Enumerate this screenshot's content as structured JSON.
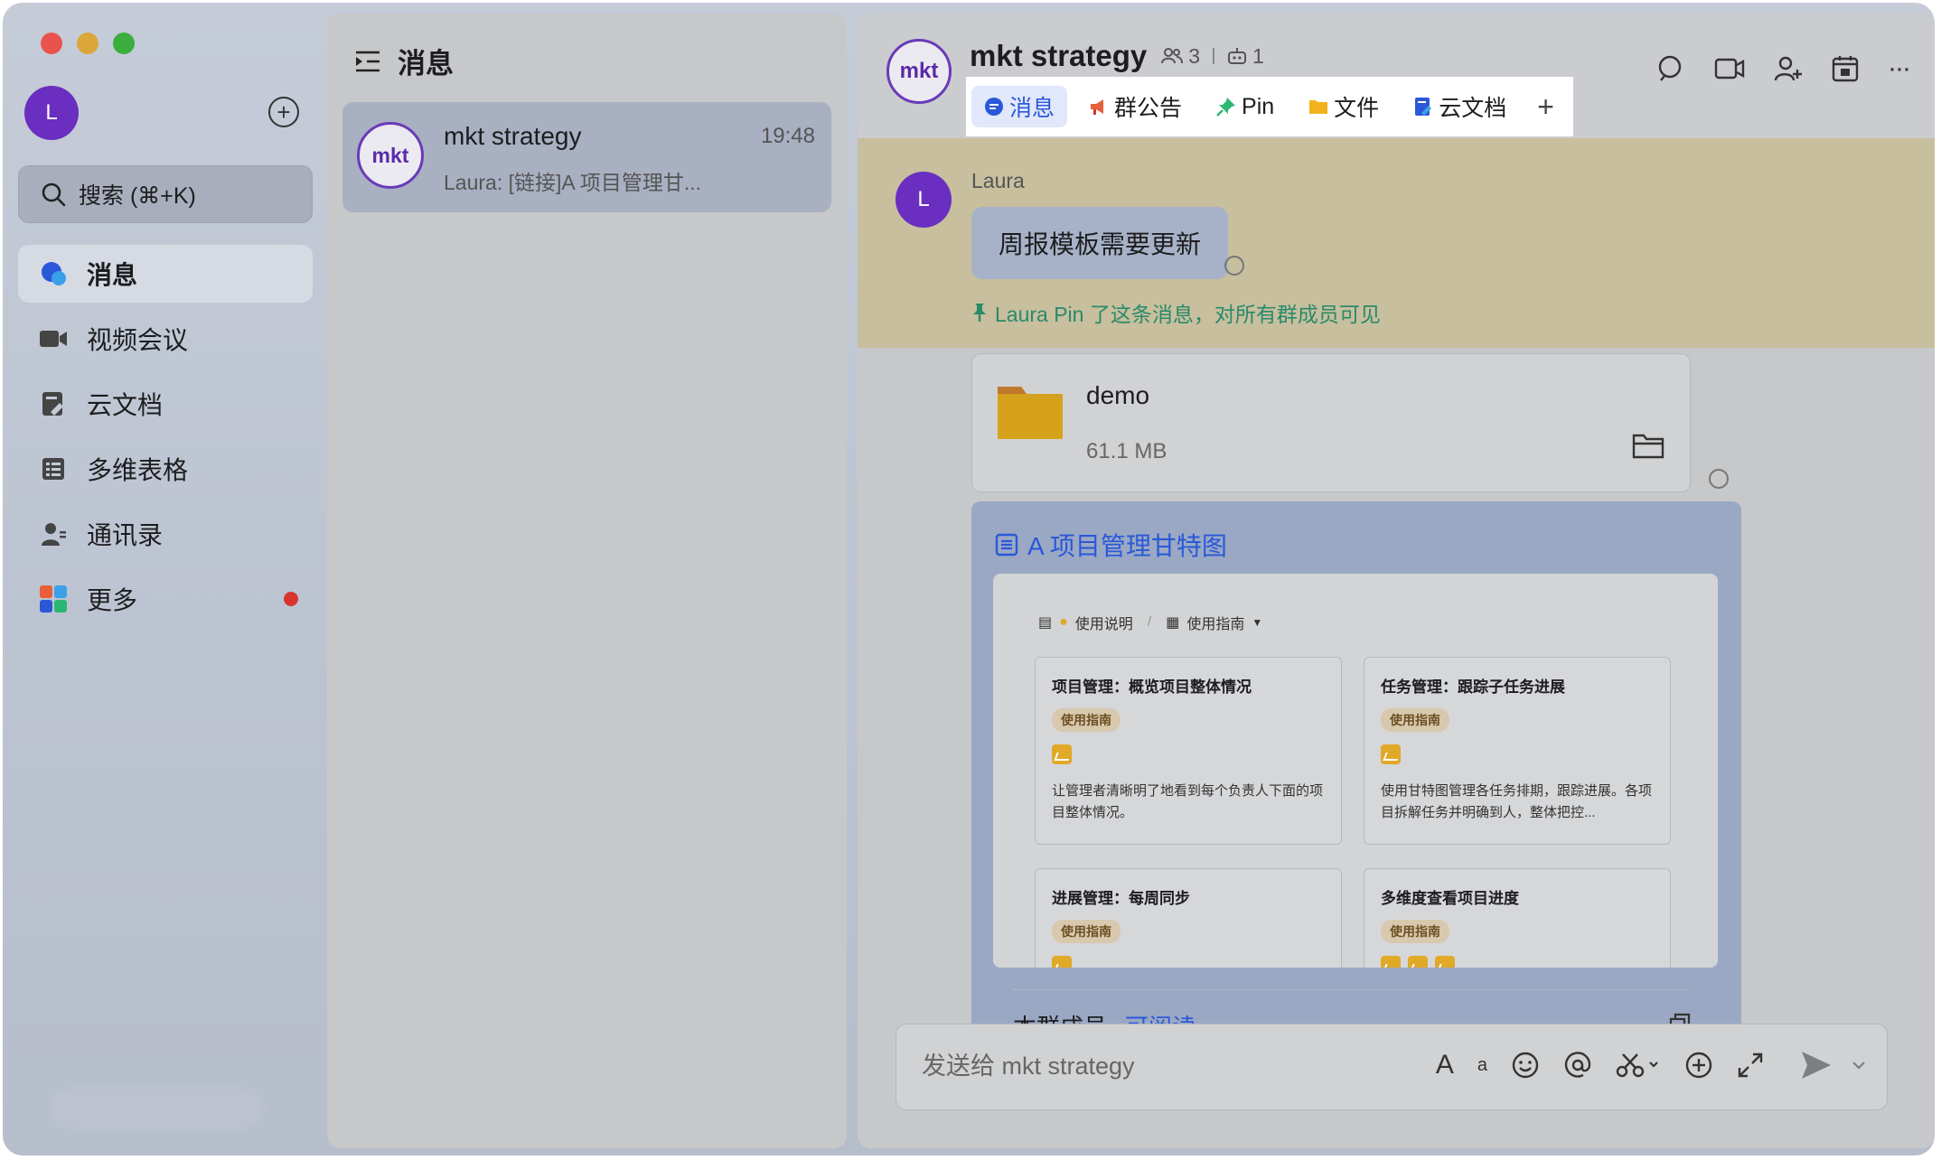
{
  "sidebar": {
    "avatar_letter": "L",
    "search_label": "搜索 (⌘+K)",
    "items": [
      {
        "label": "消息"
      },
      {
        "label": "视频会议"
      },
      {
        "label": "云文档"
      },
      {
        "label": "多维表格"
      },
      {
        "label": "通讯录"
      },
      {
        "label": "更多"
      }
    ]
  },
  "list": {
    "title": "消息",
    "conversations": [
      {
        "avatar": "mkt",
        "name": "mkt strategy",
        "time": "19:48",
        "preview": "Laura: [链接]A 项目管理甘..."
      }
    ]
  },
  "chat": {
    "avatar": "mkt",
    "title": "mkt strategy",
    "member_count": "3",
    "bot_count": "1",
    "tabs": [
      {
        "label": "消息"
      },
      {
        "label": "群公告"
      },
      {
        "label": "Pin"
      },
      {
        "label": "文件"
      },
      {
        "label": "云文档"
      }
    ],
    "tab_add": "+",
    "more": "···",
    "pinned": {
      "avatar_letter": "L",
      "sender": "Laura",
      "text": "周报模板需要更新",
      "note": "Laura Pin 了这条消息，对所有群成员可见"
    },
    "file": {
      "name": "demo",
      "size": "61.1 MB"
    },
    "doc": {
      "title": "A 项目管理甘特图",
      "bar": {
        "item1": "使用说明",
        "item2": "使用指南"
      },
      "cards": [
        {
          "title": "项目管理：概览项目整体情况",
          "tag": "使用指南",
          "desc": "让管理者清晰明了地看到每个负责人下面的项目整体情况。"
        },
        {
          "title": "任务管理：跟踪子任务进展",
          "tag": "使用指南",
          "desc": "使用甘特图管理各任务排期，跟踪进展。各项目拆解任务并明确到人，整体把控..."
        },
        {
          "title": "进展管理：每周同步",
          "tag": "使用指南",
          "desc": ""
        },
        {
          "title": "多维度查看项目进度",
          "tag": "使用指南",
          "desc": ""
        }
      ],
      "members_label": "本群成员",
      "permission": "可阅读"
    },
    "input_placeholder": "发送给 mkt strategy"
  },
  "colors": {
    "accent": "#2a58d8",
    "avatar": "#6a2ec0",
    "pin_band": "#c7bf9e",
    "pin_note": "#2a8a6a",
    "unread_dot": "#d8352f"
  }
}
